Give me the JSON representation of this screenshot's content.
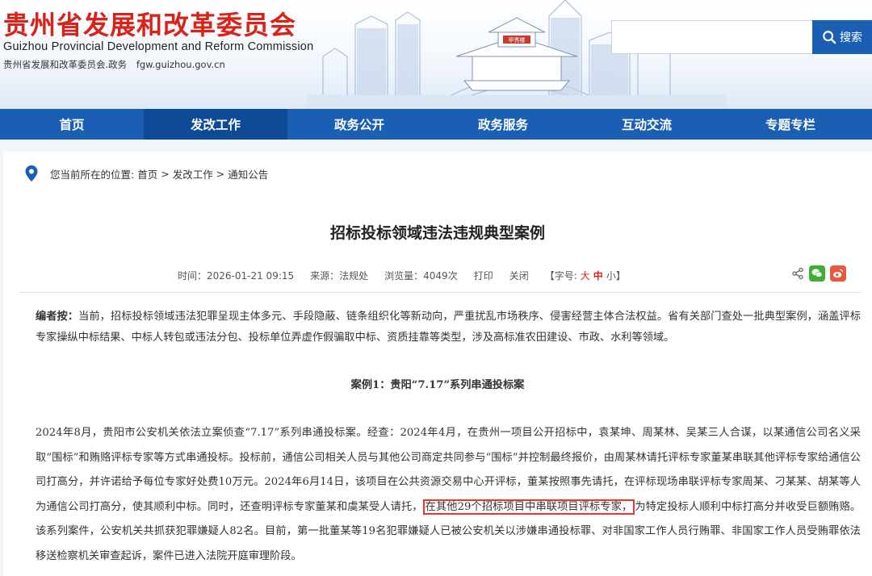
{
  "header": {
    "title_cn": "贵州省发展和改革委员会",
    "title_en": "Guizhou Provincial Development and Reform Commission",
    "domain_cn": "贵州省发展和改革委员会.政务",
    "domain_url": "fgw.guizhou.gov.cn",
    "search_placeholder": "",
    "search_label": "搜索",
    "tower_plaque": "甲秀楼"
  },
  "nav": {
    "items": [
      "首页",
      "发改工作",
      "政务公开",
      "政务服务",
      "互动交流",
      "专题专栏"
    ],
    "active_index": 1
  },
  "breadcrumb": {
    "prefix": "您当前所在的位置:",
    "items": [
      "首页",
      "发改工作",
      "通知公告"
    ],
    "separator": ">"
  },
  "article": {
    "title": "招标投标领域违法违规典型案例",
    "meta": {
      "time": "时间：2026-01-21 09:15",
      "source": "来源：法规处",
      "views": "浏览量：4049次",
      "print": "打印",
      "close": "关闭",
      "fontsize_prefix": "【字号:",
      "fontsize_big": "大",
      "fontsize_mid": "中",
      "fontsize_small": "小】"
    },
    "editor_label": "编者按：",
    "editor_note": "当前，招标投标领域违法犯罪呈现主体多元、手段隐蔽、链条组织化等新动向，严重扰乱市场秩序、侵害经营主体合法权益。省有关部门查处一批典型案例，涵盖评标专家操纵中标结果、中标人转包或违法分包、投标单位弄虚作假骗取中标、资质挂靠等类型，涉及高标准农田建设、市政、水利等领域。",
    "case1_title": "案例1：贵阳“7.17”系列串通投标案",
    "case1_text_a": "2024年8月，贵阳市公安机关依法立案侦查“7.17”系列串通投标案。经查：2024年4月，在贵州一项目公开招标中，袁某坤、周某林、吴某三人合谋，以某通信公司名义采取“围标”和贿赂评标专家等方式串通投标。投标前，通信公司相关人员与其他公司商定共同参与“围标”并控制最终报价，由周某林请托评标专家董某串联其他评标专家给通信公司打高分，并许诺给予每位专家好处费10万元。2024年6月14日，该项目在公共资源交易中心开评标，董某按照事先请托，在评标现场串联评标专家周某、刁某某、胡某等人为通信公司打高分，使其顺利中标。同时，还查明评标专家董某和虞某受人请托，",
    "case1_highlight": "在其他29个招标项目中串联项目评标专家，",
    "case1_text_b": "为特定投标人顺利中标打高分并收受巨额贿赂。该系列案件，公安机关共抓获犯罪嫌疑人82名。目前，第一批董某等19名犯罪嫌疑人已被公安机关以涉嫌串通投标罪、对非国家工作人员行贿罪、非国家工作人员受贿罪依法移送检察机关审查起诉，案件已进入法院开庭审理阶段。"
  },
  "colors": {
    "brand_red": "#d9231a",
    "nav_blue": "#1a5fb4",
    "nav_active": "#0f4a96",
    "highlight_border": "#e33"
  }
}
